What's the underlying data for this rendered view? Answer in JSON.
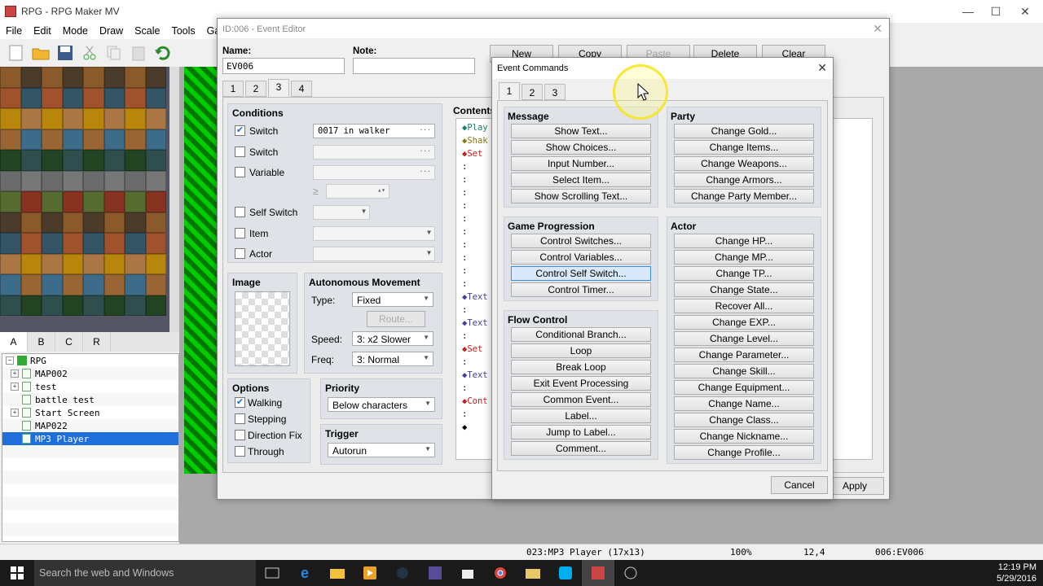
{
  "app": {
    "title": "RPG - RPG Maker MV",
    "minimize": "—",
    "maximize": "☐",
    "close": "✕"
  },
  "menu": [
    "File",
    "Edit",
    "Mode",
    "Draw",
    "Scale",
    "Tools",
    "Game"
  ],
  "tile_tabs": [
    "A",
    "B",
    "C",
    "R"
  ],
  "map_tree": {
    "root": "RPG",
    "items": [
      {
        "label": "MAP002",
        "expand": true
      },
      {
        "label": "test",
        "expand": true
      },
      {
        "label": "battle test",
        "expand": false
      },
      {
        "label": "Start Screen",
        "expand": true
      },
      {
        "label": "MAP022",
        "expand": false
      },
      {
        "label": "MP3 Player",
        "expand": false,
        "selected": true
      }
    ]
  },
  "status": {
    "map": "023:MP3 Player (17x13)",
    "zoom": "100%",
    "coords": "12,4",
    "event": "006:EV006"
  },
  "taskbar": {
    "search": "Search the web and Windows",
    "time": "12:19 PM",
    "date": "5/29/2016"
  },
  "event_editor": {
    "title": "ID:006 - Event Editor",
    "name_label": "Name:",
    "name_value": "EV006",
    "note_label": "Note:",
    "note_value": "",
    "buttons": [
      "New",
      "Copy",
      "Paste",
      "Delete",
      "Clear"
    ],
    "page_tabs": [
      "1",
      "2",
      "3",
      "4"
    ],
    "conditions": {
      "title": "Conditions",
      "switch1": {
        "label": "Switch",
        "checked": true,
        "value": "0017 in walker"
      },
      "switch2": {
        "label": "Switch"
      },
      "variable": {
        "label": "Variable"
      },
      "ge": "≥",
      "self_switch": {
        "label": "Self Switch"
      },
      "item": {
        "label": "Item"
      },
      "actor": {
        "label": "Actor"
      }
    },
    "image": {
      "title": "Image"
    },
    "movement": {
      "title": "Autonomous Movement",
      "type_label": "Type:",
      "type_value": "Fixed",
      "route": "Route...",
      "speed_label": "Speed:",
      "speed_value": "3: x2 Slower",
      "freq_label": "Freq:",
      "freq_value": "3: Normal"
    },
    "options": {
      "title": "Options",
      "walking": "Walking",
      "stepping": "Stepping",
      "direction_fix": "Direction Fix",
      "through": "Through"
    },
    "priority": {
      "title": "Priority",
      "value": "Below characters"
    },
    "trigger": {
      "title": "Trigger",
      "value": "Autorun"
    },
    "contents": {
      "title": "Contents",
      "rows": [
        "◆Play",
        "◆Shak",
        "◆Set",
        "  :",
        "  :",
        "  :",
        "  :",
        "  :",
        "  :",
        "  :",
        "  :",
        "  :",
        "  :",
        "◆Text",
        "  :",
        "◆Text",
        "  :",
        "◆Set",
        "  :",
        "◆Text",
        "  :",
        "◆Cont",
        "  :",
        "◆"
      ]
    },
    "apply": "Apply"
  },
  "event_commands": {
    "title": "Event Commands",
    "tabs": [
      "1",
      "2",
      "3"
    ],
    "message": {
      "title": "Message",
      "cmds": [
        "Show Text...",
        "Show Choices...",
        "Input Number...",
        "Select Item...",
        "Show Scrolling Text..."
      ]
    },
    "party": {
      "title": "Party",
      "cmds": [
        "Change Gold...",
        "Change Items...",
        "Change Weapons...",
        "Change Armors...",
        "Change Party Member..."
      ]
    },
    "game_progression": {
      "title": "Game Progression",
      "cmds": [
        "Control Switches...",
        "Control Variables...",
        "Control Self Switch...",
        "Control Timer..."
      ]
    },
    "actor": {
      "title": "Actor",
      "cmds": [
        "Change HP...",
        "Change MP...",
        "Change TP...",
        "Change State...",
        "Recover All...",
        "Change EXP...",
        "Change Level...",
        "Change Parameter...",
        "Change Skill...",
        "Change Equipment...",
        "Change Name...",
        "Change Class...",
        "Change Nickname...",
        "Change Profile..."
      ]
    },
    "flow_control": {
      "title": "Flow Control",
      "cmds": [
        "Conditional Branch...",
        "Loop",
        "Break Loop",
        "Exit Event Processing",
        "Common Event...",
        "Label...",
        "Jump to Label...",
        "Comment..."
      ]
    },
    "cancel": "Cancel"
  }
}
